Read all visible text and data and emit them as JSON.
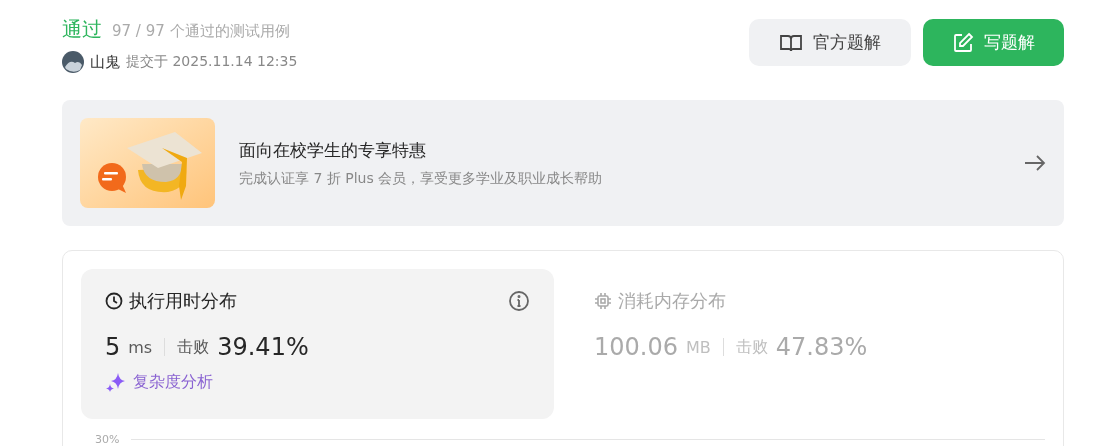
{
  "result": {
    "status": "通过",
    "cases": "97 / 97 个通过的测试用例",
    "user": "山鬼",
    "submitted": "提交于 2025.11.14 12:35"
  },
  "buttons": [
    {
      "label": "官方题解",
      "kind": "secondary"
    },
    {
      "label": "写题解",
      "kind": "primary"
    }
  ],
  "promo": {
    "title": "面向在校学生的专享特惠",
    "subtitle": "完成认证享 7 折 Plus 会员，享受更多学业及职业成长帮助"
  },
  "stats": [
    {
      "kind": "time",
      "title": "执行用时分布",
      "value": "5",
      "unit": "ms",
      "beat_label": "击败",
      "beat": "39.41%",
      "selected": true,
      "link": "复杂度分析"
    },
    {
      "kind": "memory",
      "title": "消耗内存分布",
      "value": "100.06",
      "unit": "MB",
      "beat_label": "击败",
      "beat": "47.83%",
      "selected": false
    }
  ],
  "chart_axis_label": "30%"
}
